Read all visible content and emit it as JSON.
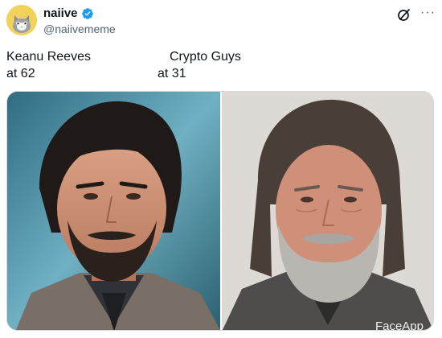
{
  "post": {
    "author": {
      "display_name": "naiive",
      "handle": "@naiivememe",
      "verified_icon": "verified-badge-icon",
      "avatar_icon": "cat-avatar"
    },
    "actions": {
      "grok_icon": "grok-icon",
      "more_icon": "more-icon",
      "more_glyph": "···"
    },
    "text": {
      "left_line1": "Keanu Reeves",
      "left_line2": "at 62",
      "right_line1": "Crypto Guys",
      "right_line2": "at 31"
    },
    "media": {
      "watermark": "FaceApp"
    }
  },
  "colors": {
    "verified_blue": "#1d9bf0",
    "text_primary": "#0f1419",
    "text_secondary": "#536471"
  }
}
